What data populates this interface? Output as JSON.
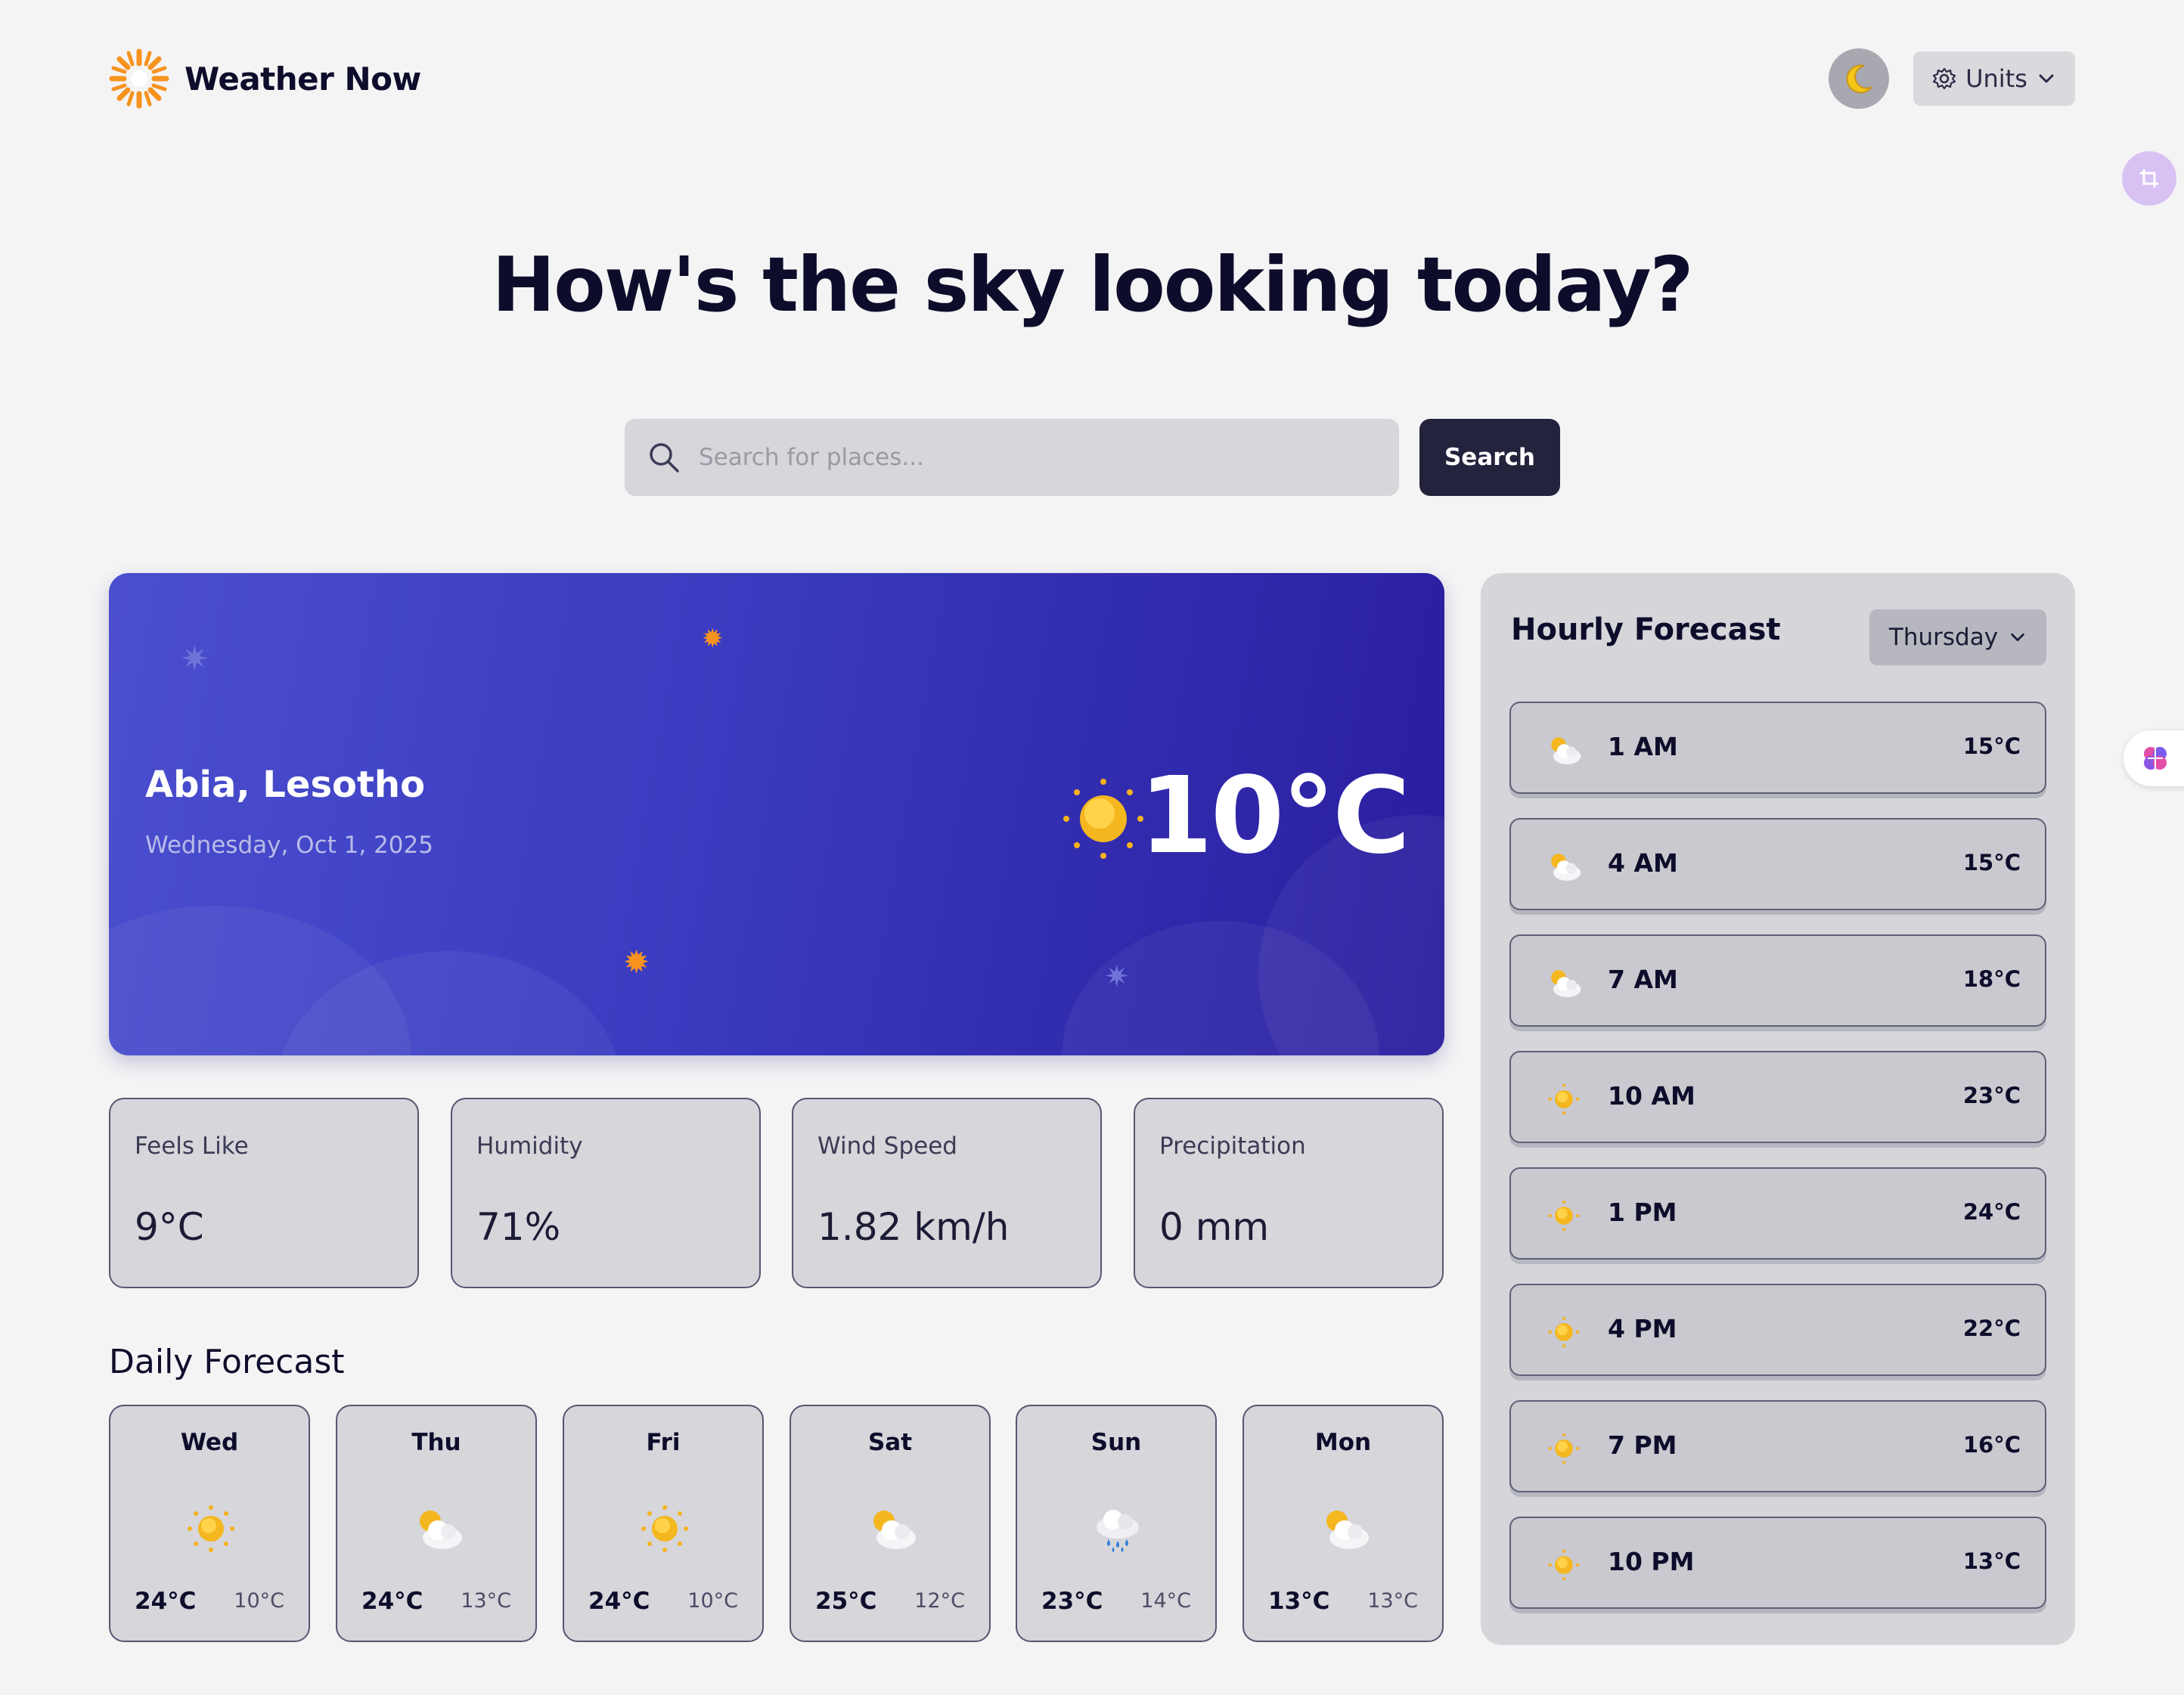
{
  "app": {
    "name": "Weather Now"
  },
  "header": {
    "units_label": "Units"
  },
  "hero": {
    "headline": "How's the sky looking today?",
    "search_placeholder": "Search for places...",
    "search_button": "Search"
  },
  "current": {
    "location": "Abia, Lesotho",
    "date": "Wednesday, Oct 1, 2025",
    "temperature": "10°C",
    "condition_icon": "sun-icon"
  },
  "metrics": [
    {
      "label": "Feels Like",
      "value": "9°C"
    },
    {
      "label": "Humidity",
      "value": "71%"
    },
    {
      "label": "Wind Speed",
      "value": "1.82 km/h"
    },
    {
      "label": "Precipitation",
      "value": "0 mm"
    }
  ],
  "daily": {
    "title": "Daily Forecast",
    "days": [
      {
        "day": "Wed",
        "icon": "sunny-icon",
        "high": "24°C",
        "low": "10°C"
      },
      {
        "day": "Thu",
        "icon": "partly-cloudy-icon",
        "high": "24°C",
        "low": "13°C"
      },
      {
        "day": "Fri",
        "icon": "sunny-icon",
        "high": "24°C",
        "low": "10°C"
      },
      {
        "day": "Sat",
        "icon": "partly-cloudy-icon",
        "high": "25°C",
        "low": "12°C"
      },
      {
        "day": "Sun",
        "icon": "rain-icon",
        "high": "23°C",
        "low": "14°C"
      },
      {
        "day": "Mon",
        "icon": "partly-cloudy-icon",
        "high": "13°C",
        "low": "13°C"
      }
    ]
  },
  "hourly": {
    "title": "Hourly Forecast",
    "selected_day": "Thursday",
    "hours": [
      {
        "time": "1 AM",
        "icon": "partly-cloudy-icon",
        "temp": "15°C"
      },
      {
        "time": "4 AM",
        "icon": "partly-cloudy-icon",
        "temp": "15°C"
      },
      {
        "time": "7 AM",
        "icon": "partly-cloudy-icon",
        "temp": "18°C"
      },
      {
        "time": "10 AM",
        "icon": "sunny-icon",
        "temp": "23°C"
      },
      {
        "time": "1 PM",
        "icon": "sunny-icon",
        "temp": "24°C"
      },
      {
        "time": "4 PM",
        "icon": "sunny-icon",
        "temp": "22°C"
      },
      {
        "time": "7 PM",
        "icon": "sunny-icon",
        "temp": "16°C"
      },
      {
        "time": "10 PM",
        "icon": "sunny-icon",
        "temp": "13°C"
      }
    ]
  },
  "colors": {
    "background": "#f4f4f5",
    "card_gradient_start": "#4a4fce",
    "card_gradient_end": "#2a1d9e",
    "search_button": "#24233d",
    "accent_orange": "#f7931e"
  }
}
